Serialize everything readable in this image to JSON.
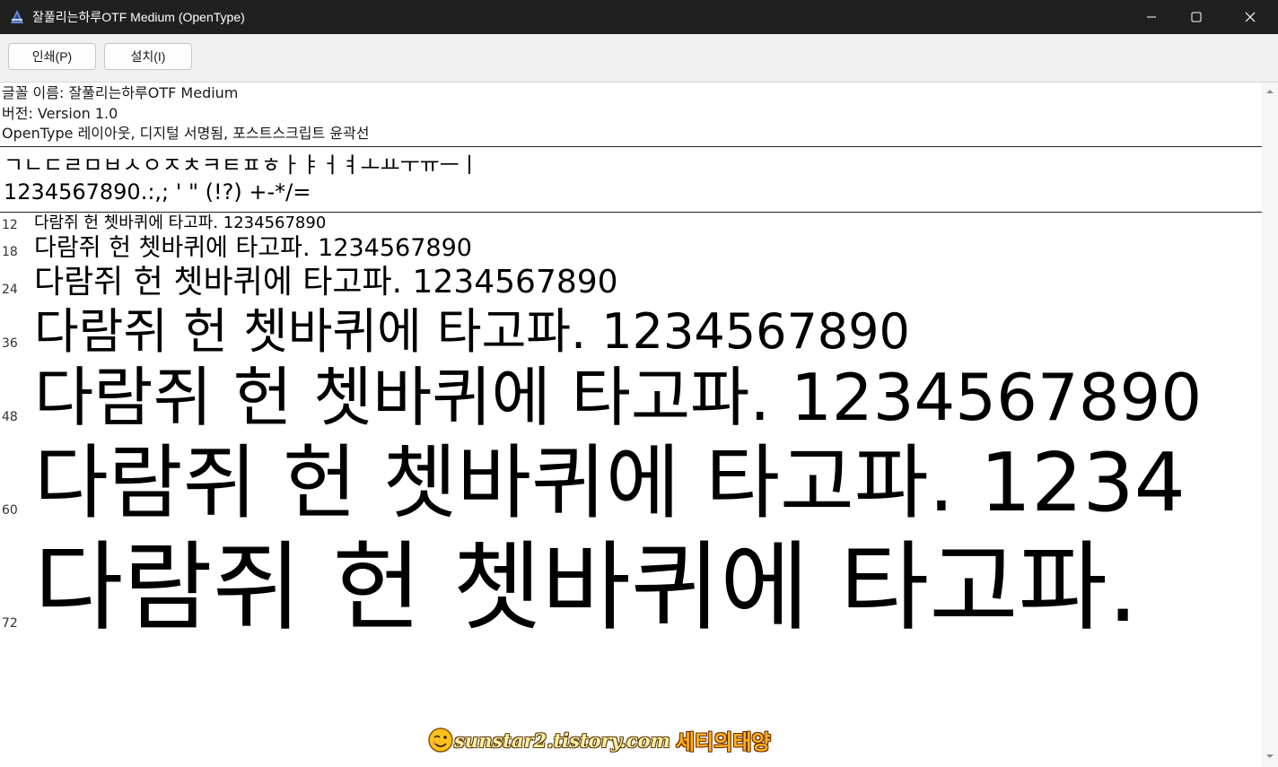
{
  "window": {
    "title": "잘풀리는하루OTF Medium (OpenType)",
    "icon": "font-viewer-icon",
    "controls": [
      "minimize-icon",
      "maximize-icon",
      "close-icon"
    ]
  },
  "toolbar": {
    "print_label": "인쇄(P)",
    "install_label": "설치(I)"
  },
  "info": {
    "font_name_line": "글꼴 이름: 잘풀리는하루OTF Medium",
    "version_line": "버전: Version 1.0",
    "type_line": "OpenType 레이아웃, 디지털 서명됨, 포스트스크립트 윤곽선"
  },
  "charset": {
    "jamo": "ㄱㄴㄷㄹㅁㅂㅅㅇㅈㅊㅋㅌㅍㅎㅏㅑㅓㅕㅗㅛㅜㅠㅡㅣ",
    "digits_punct": "1234567890.:,; ' \" (!?) +-*/="
  },
  "samples": [
    {
      "size": "12",
      "text": "다람쥐 헌 쳇바퀴에 타고파. 1234567890"
    },
    {
      "size": "18",
      "text": "다람쥐 헌 쳇바퀴에 타고파. 1234567890"
    },
    {
      "size": "24",
      "text": "다람쥐 헌 쳇바퀴에 타고파. 1234567890"
    },
    {
      "size": "36",
      "text": "다람쥐 헌 쳇바퀴에 타고파. 1234567890"
    },
    {
      "size": "48",
      "text": "다람쥐 헌 쳇바퀴에 타고파. 1234567890"
    },
    {
      "size": "60",
      "text": "다람쥐 헌 쳇바퀴에 타고파. 1234"
    },
    {
      "size": "72",
      "text": "다람쥐 헌 쳇바퀴에 타고파."
    }
  ],
  "watermark": {
    "url": "sunstar2.tistory.com",
    "name": "세티의태양",
    "icon": "smiley-icon"
  }
}
